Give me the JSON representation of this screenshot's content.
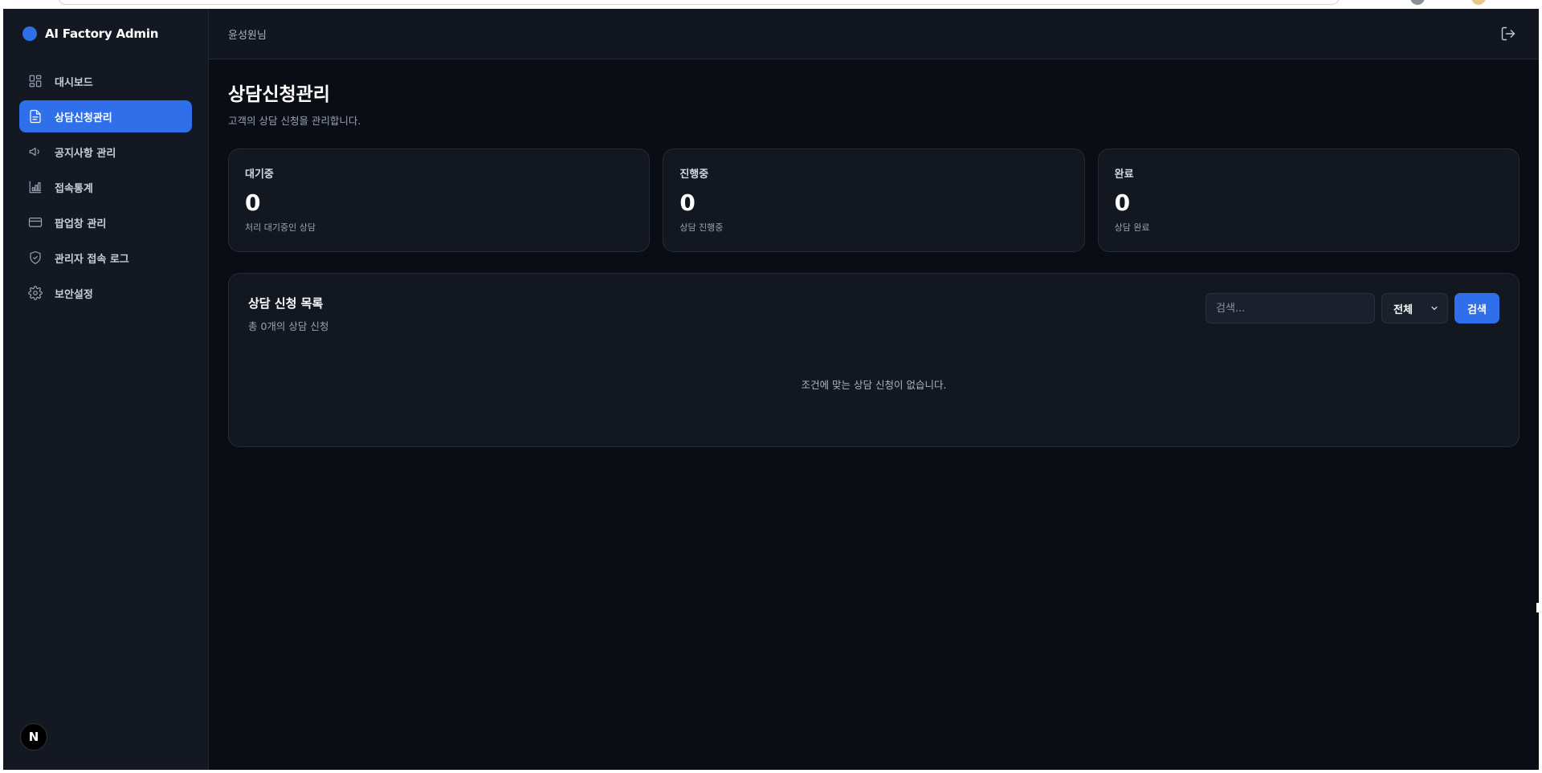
{
  "brand": {
    "title": "AI Factory Admin",
    "accent": "#2f6fea"
  },
  "sidebar": {
    "items": [
      {
        "label": "대시보드",
        "icon": "dashboard-icon",
        "active": false
      },
      {
        "label": "상담신청관리",
        "icon": "document-icon",
        "active": true
      },
      {
        "label": "공지사항 관리",
        "icon": "megaphone-icon",
        "active": false
      },
      {
        "label": "접속통계",
        "icon": "bar-chart-icon",
        "active": false
      },
      {
        "label": "팝업창 관리",
        "icon": "card-icon",
        "active": false
      },
      {
        "label": "관리자 접속 로그",
        "icon": "shield-check-icon",
        "active": false
      },
      {
        "label": "보안설정",
        "icon": "gear-icon",
        "active": false
      }
    ],
    "badge": "N"
  },
  "topbar": {
    "user_name": "윤성원님"
  },
  "page": {
    "title": "상담신청관리",
    "subtitle": "고객의 상담 신청을 관리합니다."
  },
  "stats": [
    {
      "label": "대기중",
      "value": "0",
      "desc": "처리 대기중인 상담"
    },
    {
      "label": "진행중",
      "value": "0",
      "desc": "상담 진행중"
    },
    {
      "label": "완료",
      "value": "0",
      "desc": "상담 완료"
    }
  ],
  "list": {
    "title": "상담 신청 목록",
    "count": "총 0개의 상담 신청",
    "search_placeholder": "검색...",
    "filter_value": "전체",
    "search_button": "검색",
    "empty_message": "조건에 맞는 상담 신청이 없습니다."
  }
}
